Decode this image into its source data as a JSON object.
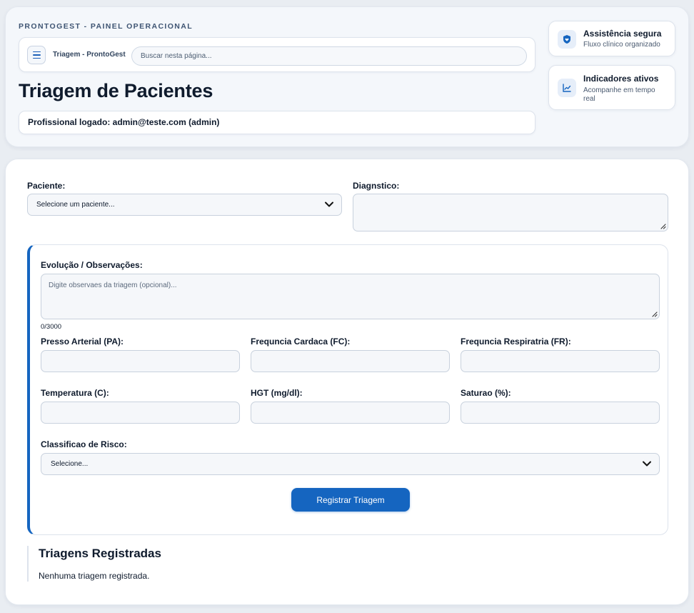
{
  "header": {
    "brand_tag": "PRONTOGEST - PAINEL OPERACIONAL",
    "topbar_title": "Triagem - ProntoGest",
    "search_placeholder": "Buscar nesta página...",
    "page_title": "Triagem de Pacientes",
    "user_line": "Profissional logado: admin@teste.com (admin)",
    "info_cards": [
      {
        "title": "Assistência segura",
        "subtitle": "Fluxo clínico organizado",
        "icon": "shield-heart-icon"
      },
      {
        "title": "Indicadores ativos",
        "subtitle": "Acompanhe em tempo real",
        "icon": "line-chart-icon"
      }
    ]
  },
  "form": {
    "patient_label": "Paciente:",
    "patient_selected": "Selecione um paciente...",
    "diagnosis_label": "Diagnstico:",
    "diagnosis_value": "",
    "evolution_label": "Evolução / Observações:",
    "evolution_placeholder": "Digite observaes da triagem (opcional)...",
    "char_counter": "0/3000",
    "vitals": [
      {
        "label": "Presso Arterial (PA):",
        "value": ""
      },
      {
        "label": "Frequncia Cardaca (FC):",
        "value": ""
      },
      {
        "label": "Frequncia Respiratria (FR):",
        "value": ""
      },
      {
        "label": "Temperatura (C):",
        "value": ""
      },
      {
        "label": "HGT (mg/dl):",
        "value": ""
      },
      {
        "label": "Saturao (%):",
        "value": ""
      }
    ],
    "risk_label": "Classificao de Risco:",
    "risk_selected": "Selecione...",
    "submit_label": "Registrar Triagem"
  },
  "registered": {
    "title": "Triagens Registradas",
    "empty_message": "Nenhuma triagem registrada."
  },
  "colors": {
    "accent": "#1565c0",
    "page_bg": "#e9edf2",
    "text": "#0f1b2d"
  }
}
